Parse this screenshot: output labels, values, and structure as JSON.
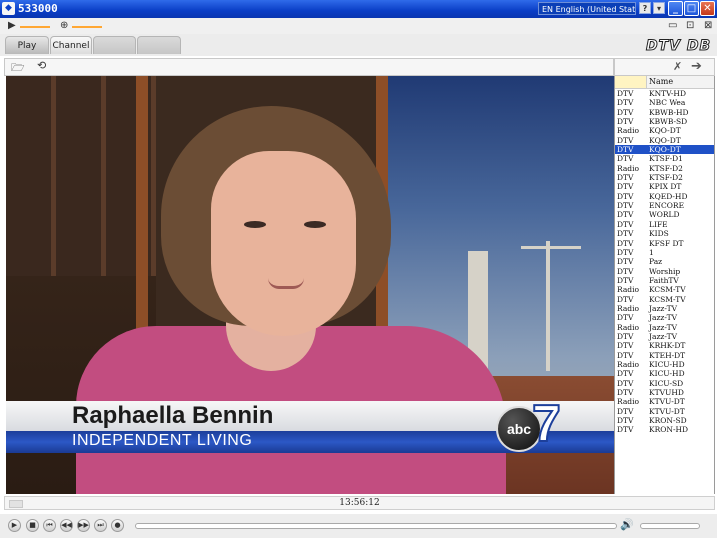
{
  "window": {
    "title": "533000",
    "app_icon": "app-icon",
    "language": "EN English (United States)"
  },
  "tabs": [
    {
      "label": "Play"
    },
    {
      "label": "Channel"
    },
    {
      "label": ""
    },
    {
      "label": ""
    }
  ],
  "logo": {
    "text": "DTV DB"
  },
  "video": {
    "lower_third_name": "Raphaella Bennin",
    "lower_third_subtitle": "INDEPENDENT LIVING",
    "station_logo_text": "abc",
    "station_number": "7"
  },
  "channel_list": {
    "header_name": "Name",
    "selected_index": 6,
    "rows": [
      {
        "type": "DTV",
        "name": "KNTV-HD"
      },
      {
        "type": "DTV",
        "name": "NBC Wea"
      },
      {
        "type": "DTV",
        "name": "KBWB-HD"
      },
      {
        "type": "DTV",
        "name": "KBWB-SD"
      },
      {
        "type": "Radio",
        "name": "KQO-DT"
      },
      {
        "type": "DTV",
        "name": "KQO-DT"
      },
      {
        "type": "DTV",
        "name": "KQO-DT"
      },
      {
        "type": "DTV",
        "name": "KTSF-D1"
      },
      {
        "type": "Radio",
        "name": "KTSF-D2"
      },
      {
        "type": "DTV",
        "name": "KTSF-D2"
      },
      {
        "type": "DTV",
        "name": "KPIX DT"
      },
      {
        "type": "DTV",
        "name": "KQED-HD"
      },
      {
        "type": "DTV",
        "name": "ENCORE"
      },
      {
        "type": "DTV",
        "name": "WORLD"
      },
      {
        "type": "DTV",
        "name": "LIFE"
      },
      {
        "type": "DTV",
        "name": "KIDS"
      },
      {
        "type": "DTV",
        "name": "KFSF DT"
      },
      {
        "type": "DTV",
        "name": "1"
      },
      {
        "type": "DTV",
        "name": "Paz"
      },
      {
        "type": "DTV",
        "name": "Worship"
      },
      {
        "type": "DTV",
        "name": "FaithTV"
      },
      {
        "type": "Radio",
        "name": "KCSM-TV"
      },
      {
        "type": "DTV",
        "name": "KCSM-TV"
      },
      {
        "type": "Radio",
        "name": "Jazz-TV"
      },
      {
        "type": "DTV",
        "name": "Jazz-TV"
      },
      {
        "type": "Radio",
        "name": "Jazz-TV"
      },
      {
        "type": "DTV",
        "name": "Jazz-TV"
      },
      {
        "type": "DTV",
        "name": "KRHK-DT"
      },
      {
        "type": "DTV",
        "name": "KTEH-DT"
      },
      {
        "type": "Radio",
        "name": "KICU-HD"
      },
      {
        "type": "DTV",
        "name": "KICU-HD"
      },
      {
        "type": "DTV",
        "name": "KICU-SD"
      },
      {
        "type": "DTV",
        "name": "KTVUHD"
      },
      {
        "type": "Radio",
        "name": "KTVU-DT"
      },
      {
        "type": "DTV",
        "name": "KTVU-DT"
      },
      {
        "type": "DTV",
        "name": "KRON-SD"
      },
      {
        "type": "DTV",
        "name": "KRON-HD"
      }
    ]
  },
  "status": {
    "time": "13:56:12"
  },
  "icons": {
    "play": "play-icon",
    "stop": "stop-icon",
    "prev": "skip-back-icon",
    "rew": "rewind-icon",
    "ff": "fast-forward-icon",
    "next": "skip-forward-icon",
    "record": "record-icon",
    "volume": "volume-icon",
    "open": "folder-open-icon",
    "refresh": "refresh-icon",
    "settings": "wrench-icon",
    "arrow": "arrow-right-icon"
  },
  "colors": {
    "titlebar": "#0a3ec6",
    "selection": "#1f51c7",
    "lower_third_blue": "#2c58c6",
    "accent": "#ffa733"
  }
}
